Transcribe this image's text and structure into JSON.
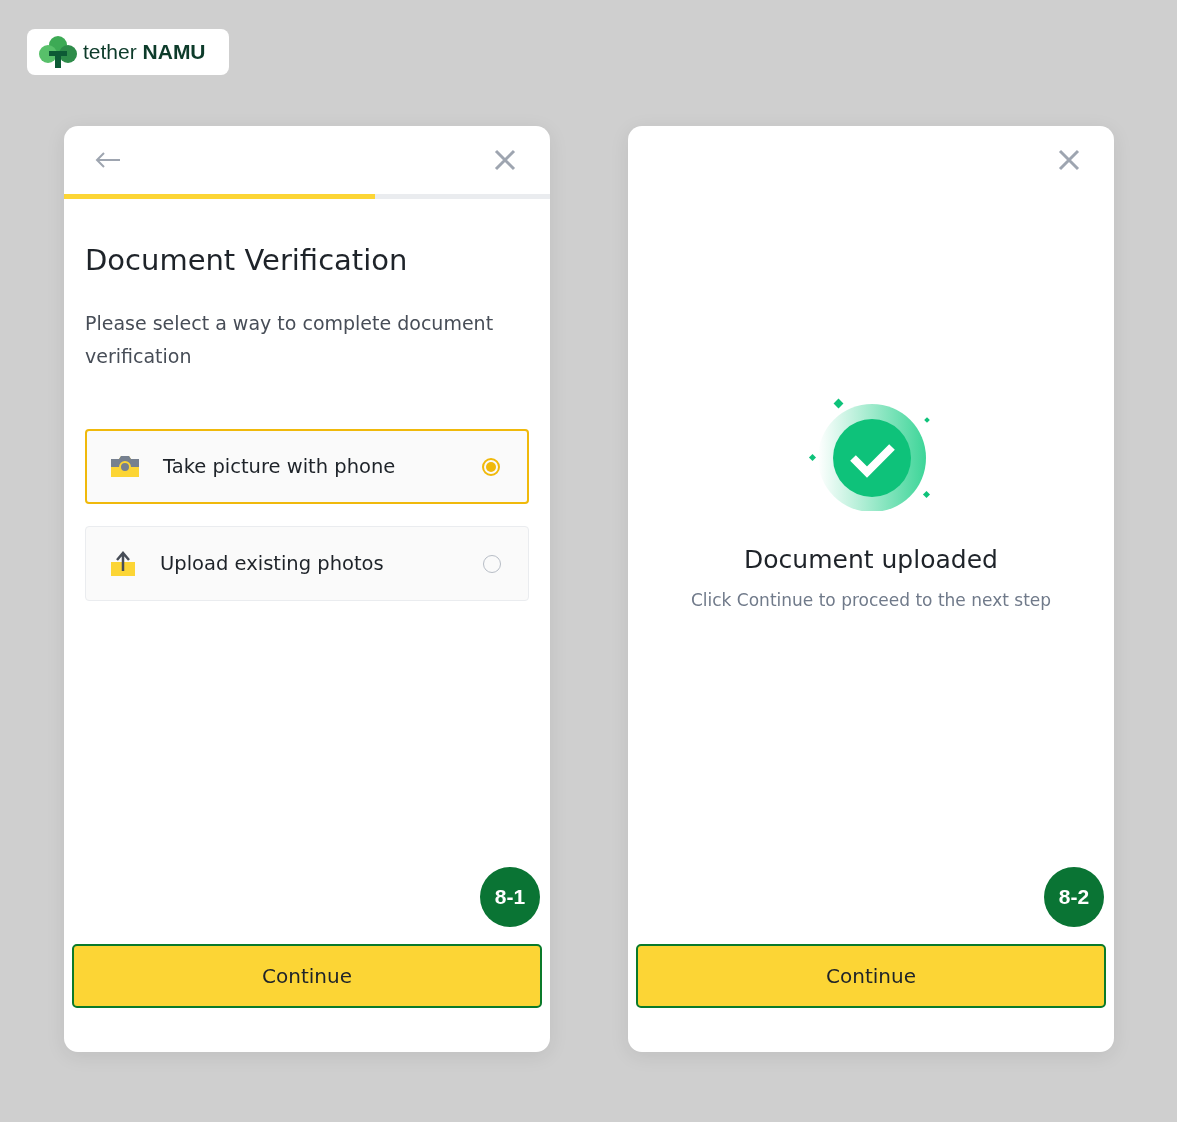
{
  "logo": {
    "brand_light": "tether",
    "brand_bold": "NAMU"
  },
  "screens": [
    {
      "kind": "options",
      "back_button": true,
      "progress": {
        "level": 0.64
      },
      "title": "Document Verification",
      "description": "Please select a way to complete document verification",
      "options": [
        {
          "label": "Take picture with phone",
          "kind": "camera",
          "selected": true
        },
        {
          "label": "Upload existing photos",
          "kind": "upload",
          "selected": false
        }
      ],
      "step_badge": "8-1",
      "button": "Continue"
    },
    {
      "kind": "success",
      "back_button": false,
      "title": "Document uploaded",
      "description": "Click Continue to proceed to the next step",
      "step_badge": "8-2",
      "button": "Continue"
    }
  ]
}
